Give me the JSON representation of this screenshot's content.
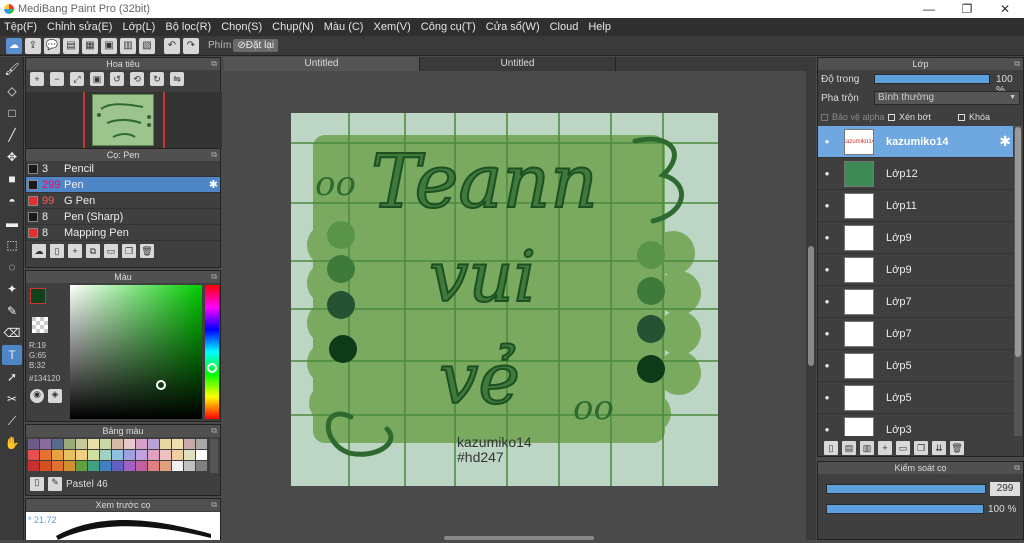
{
  "window": {
    "title": "MediBang Paint Pro (32bit)",
    "min": "—",
    "max": "❐",
    "close": "✕"
  },
  "menu": [
    "Tệp(F)",
    "Chỉnh sửa(E)",
    "Lớp(L)",
    "Bộ lọc(R)",
    "Chọn(S)",
    "Chụp(N)",
    "Màu (C)",
    "Xem(V)",
    "Công cụ(T)",
    "Cửa sổ(W)",
    "Cloud",
    "Help"
  ],
  "toolbar": {
    "shortcut_label": "Phím",
    "reset_label": "Đặt lại"
  },
  "navigator": {
    "title": "Hoa tiêu"
  },
  "brush": {
    "title": "Cọ: Pen",
    "items": [
      {
        "size": "3",
        "name": "Pencil",
        "color": "#1a1a1a"
      },
      {
        "size": "299",
        "name": "Pen",
        "color": "#1a1a1a",
        "selected": true
      },
      {
        "size": "99",
        "name": "G Pen",
        "color": "#e03030"
      },
      {
        "size": "8",
        "name": "Pen (Sharp)",
        "color": "#1a1a1a"
      },
      {
        "size": "8",
        "name": "Mapping Pen",
        "color": "#e03030"
      }
    ]
  },
  "color": {
    "title": "Màu",
    "r": "R:19",
    "g": "G:65",
    "b": "B:32",
    "hex": "#134120",
    "current": "#134120"
  },
  "palette": {
    "title": "Bảng màu",
    "name": "Pastel 46"
  },
  "brushpreview": {
    "title": "Xem trước cọ",
    "size": "* 21.72"
  },
  "tabs": [
    "Untitled",
    "Untitled"
  ],
  "canvas": {
    "line1": "Teann",
    "line2": "vui",
    "line3": "vẻ",
    "sig1": "kazumiko14",
    "sig2": "#hd247",
    "open_deco": "oo",
    "close_deco": "oo"
  },
  "layer": {
    "title": "Lớp",
    "opacity_label": "Độ trong",
    "opacity_value": "100 %",
    "opacity": 1.0,
    "blend_label": "Pha trộn",
    "blend_value": "Bình thường",
    "alpha_label": "Bảo vệ alpha",
    "clip_label": "Xén bớt",
    "lock_label": "Khóa",
    "items": [
      {
        "name": "kazumiko14",
        "thumb": "kazumiko14",
        "selected": true
      },
      {
        "name": "Lớp12",
        "thumb": ""
      },
      {
        "name": "Lớp11",
        "thumb": ""
      },
      {
        "name": "Lớp9",
        "thumb": ""
      },
      {
        "name": "Lớp9",
        "thumb": ""
      },
      {
        "name": "Lớp7",
        "thumb": ""
      },
      {
        "name": "Lớp7",
        "thumb": ""
      },
      {
        "name": "Lớp5",
        "thumb": ""
      },
      {
        "name": "Lớp5",
        "thumb": ""
      },
      {
        "name": "Lớp3",
        "thumb": ""
      }
    ]
  },
  "brushcontrol": {
    "title": "Kiểm soát cọ",
    "size": "299",
    "opacity": "100 %",
    "size_fraction": 0.93,
    "opacity_fraction": 1.0
  }
}
